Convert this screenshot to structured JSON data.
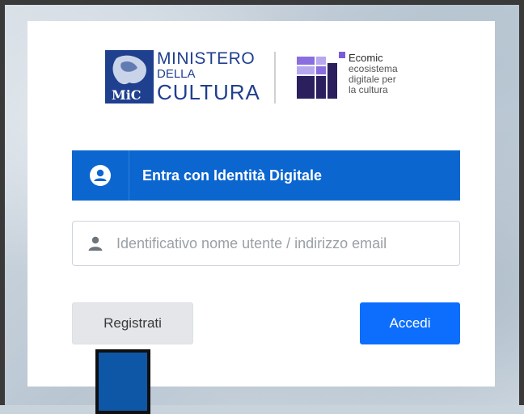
{
  "logos": {
    "mic": {
      "emblem_text": "MiC",
      "line1": "MINISTERO",
      "line2": "DELLA",
      "line3": "CULTURA"
    },
    "ecomic": {
      "line1": "Ecomic",
      "line2": "ecosistema",
      "line3": "digitale per",
      "line4": "la cultura"
    }
  },
  "spid": {
    "label": "Entra con Identità Digitale",
    "icon": "user-circle-icon"
  },
  "username": {
    "value": "",
    "placeholder": "Identificativo nome utente / indirizzo email",
    "icon": "user-icon"
  },
  "actions": {
    "register_label": "Registrati",
    "login_label": "Accedi"
  },
  "colors": {
    "brand_blue": "#0b66d0",
    "primary": "#0d6efd",
    "mic_blue": "#1f3f8f",
    "eco_purple": "#7b5cd6",
    "eco_dark": "#2b1f5e"
  }
}
